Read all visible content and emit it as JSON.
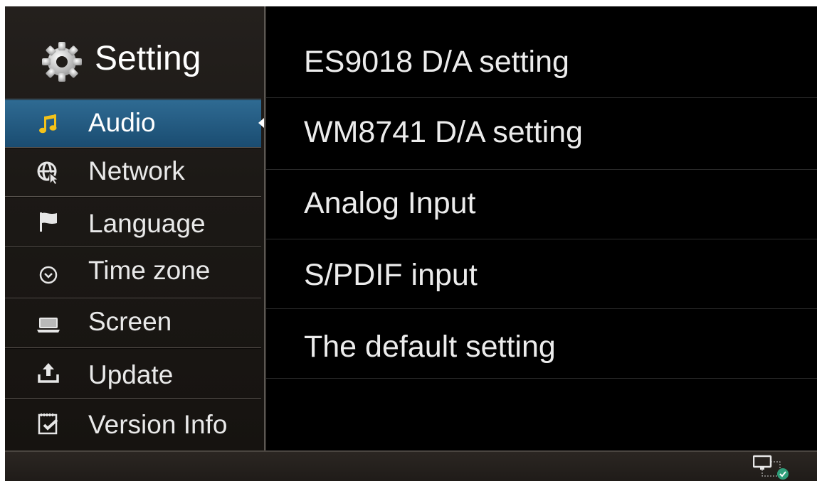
{
  "sidebar": {
    "title": "Setting",
    "title_icon": "gear-icon",
    "items": [
      {
        "label": "Audio",
        "icon": "music-note-icon",
        "active": true
      },
      {
        "label": "Network",
        "icon": "globe-cursor-icon",
        "active": false
      },
      {
        "label": "Language",
        "icon": "flag-icon",
        "active": false
      },
      {
        "label": "Time zone",
        "icon": "clock-icon",
        "active": false
      },
      {
        "label": "Screen",
        "icon": "laptop-icon",
        "active": false
      },
      {
        "label": "Update",
        "icon": "upload-icon",
        "active": false
      },
      {
        "label": "Version Info",
        "icon": "notepad-check-icon",
        "active": false
      }
    ]
  },
  "main": {
    "items": [
      {
        "label": "ES9018 D/A setting"
      },
      {
        "label": "WM8741 D/A setting"
      },
      {
        "label": "Analog Input"
      },
      {
        "label": "S/PDIF input"
      },
      {
        "label": "The default setting"
      }
    ]
  },
  "statusbar": {
    "network_icon": "network-connected-icon"
  },
  "colors": {
    "active_item": "#2a6189",
    "sidebar_bg": "#1e1a17",
    "main_bg": "#000000",
    "accent_green": "#2f9e7a"
  }
}
